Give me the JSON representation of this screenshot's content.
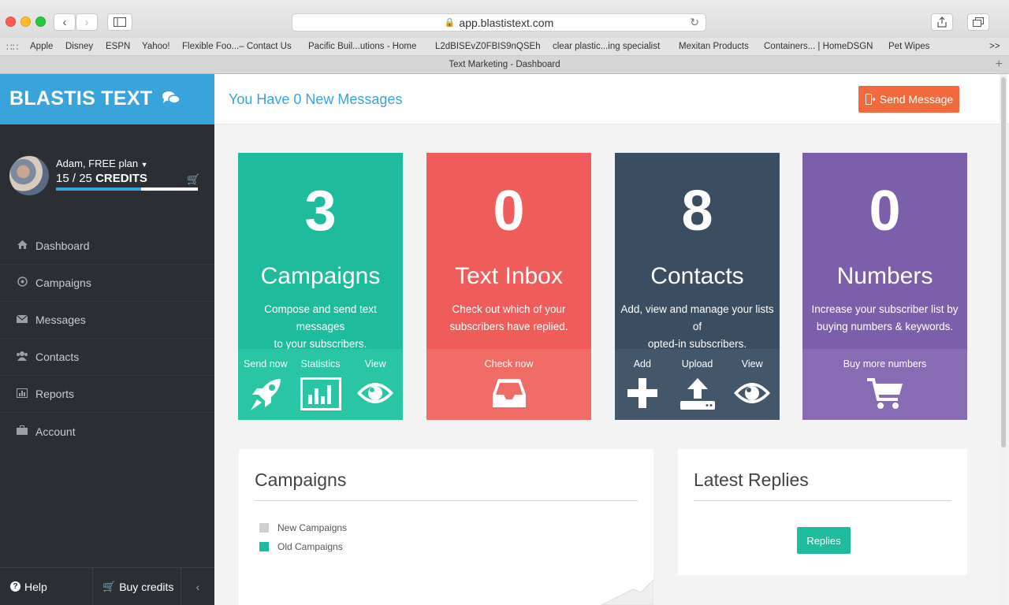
{
  "browser": {
    "url": "app.blastistext.com",
    "tab_title": "Text Marketing - Dashboard",
    "bookmarks": [
      "Apple",
      "Disney",
      "ESPN",
      "Yahoo!",
      "Flexible Foo...– Contact Us",
      "Pacific Buil...utions - Home",
      "L2dBISEvZ0FBIS9nQSEh",
      "clear plastic...ing specialist",
      "Mexitan Products",
      "Containers... | HomeDSGN",
      "Pet Wipes"
    ],
    "overflow": ">>"
  },
  "sidebar": {
    "brand": "BLASTIS TEXT",
    "user": "Adam, FREE plan",
    "credits_used": "15",
    "credits_total": "25",
    "credits_label": "CREDITS",
    "credits_progress": 0.6,
    "menu": [
      {
        "label": "Dashboard",
        "icon": "home-icon"
      },
      {
        "label": "Campaigns",
        "icon": "target-icon"
      },
      {
        "label": "Messages",
        "icon": "envelope-icon"
      },
      {
        "label": "Contacts",
        "icon": "users-icon"
      },
      {
        "label": "Reports",
        "icon": "bar-chart-icon"
      },
      {
        "label": "Account",
        "icon": "briefcase-icon"
      }
    ],
    "footer": {
      "help": "Help",
      "buy": "Buy credits"
    }
  },
  "header": {
    "new_messages": "You Have 0 New Messages",
    "send_button": "Send Message"
  },
  "cards": [
    {
      "number": "3",
      "title": "Campaigns",
      "desc1": "Compose and send text messages",
      "desc2": "to your subscribers.",
      "actions": [
        "Send now",
        "Statistics",
        "View"
      ],
      "color": "#1ebc9c"
    },
    {
      "number": "0",
      "title": "Text Inbox",
      "desc1": "Check out which of your",
      "desc2": "subscribers have replied.",
      "actions": [
        "Check now"
      ],
      "color": "#ef5d5a"
    },
    {
      "number": "8",
      "title": "Contacts",
      "desc1": "Add, view and manage your lists of",
      "desc2": "opted-in subscribers.",
      "actions": [
        "Add",
        "Upload",
        "View"
      ],
      "color": "#3b4d61"
    },
    {
      "number": "0",
      "title": "Numbers",
      "desc1": "Increase your subscriber list by",
      "desc2": "buying numbers & keywords.",
      "actions": [
        "Buy more numbers"
      ],
      "color": "#7c5faa"
    }
  ],
  "campaigns_panel": {
    "title": "Campaigns",
    "legend": [
      {
        "label": "New Campaigns",
        "color": "#d0d0d0"
      },
      {
        "label": "Old Campaigns",
        "color": "#1ebc9c"
      }
    ]
  },
  "replies_panel": {
    "title": "Latest Replies",
    "button": "Replies"
  }
}
